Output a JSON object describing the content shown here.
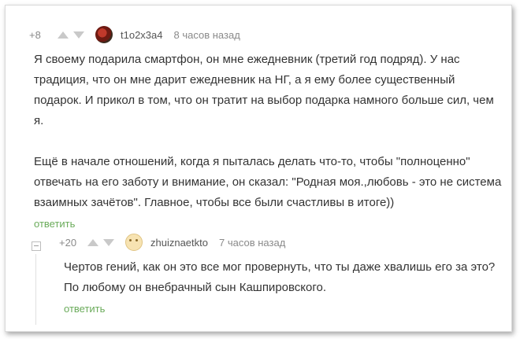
{
  "comments": [
    {
      "rating": "+8",
      "author": "t1o2x3a4",
      "time": "8 часов назад",
      "text": "Я своему подарила смартфон, он мне ежедневник (третий год подряд). У нас традиция, что он мне дарит ежедневник на НГ, а я ему более существенный подарок. И прикол в том, что он тратит на выбор подарка намного больше сил, чем я.\n\nЕщё в начале отношений, когда я пыталась делать что-то, чтобы \"полноценно\" отвечать на его заботу и внимание, он сказал: \"Родная моя.,любовь - это не система взаимных зачётов\". Главное, чтобы все были счастливы в итоге))",
      "reply": "ответить"
    },
    {
      "rating": "+20",
      "author": "zhuiznaetkto",
      "time": "7 часов назад",
      "text": "Чертов гений, как он это все мог провернуть, что ты даже хвалишь его за это? По любому он внебрачный сын Кашпировского.",
      "reply": "ответить"
    }
  ],
  "colors": {
    "reply_link": "#6aab5a",
    "meta": "#8a8a8a",
    "text": "#333333"
  },
  "icons": [
    "vote-up-icon",
    "vote-down-icon",
    "collapse-icon"
  ]
}
